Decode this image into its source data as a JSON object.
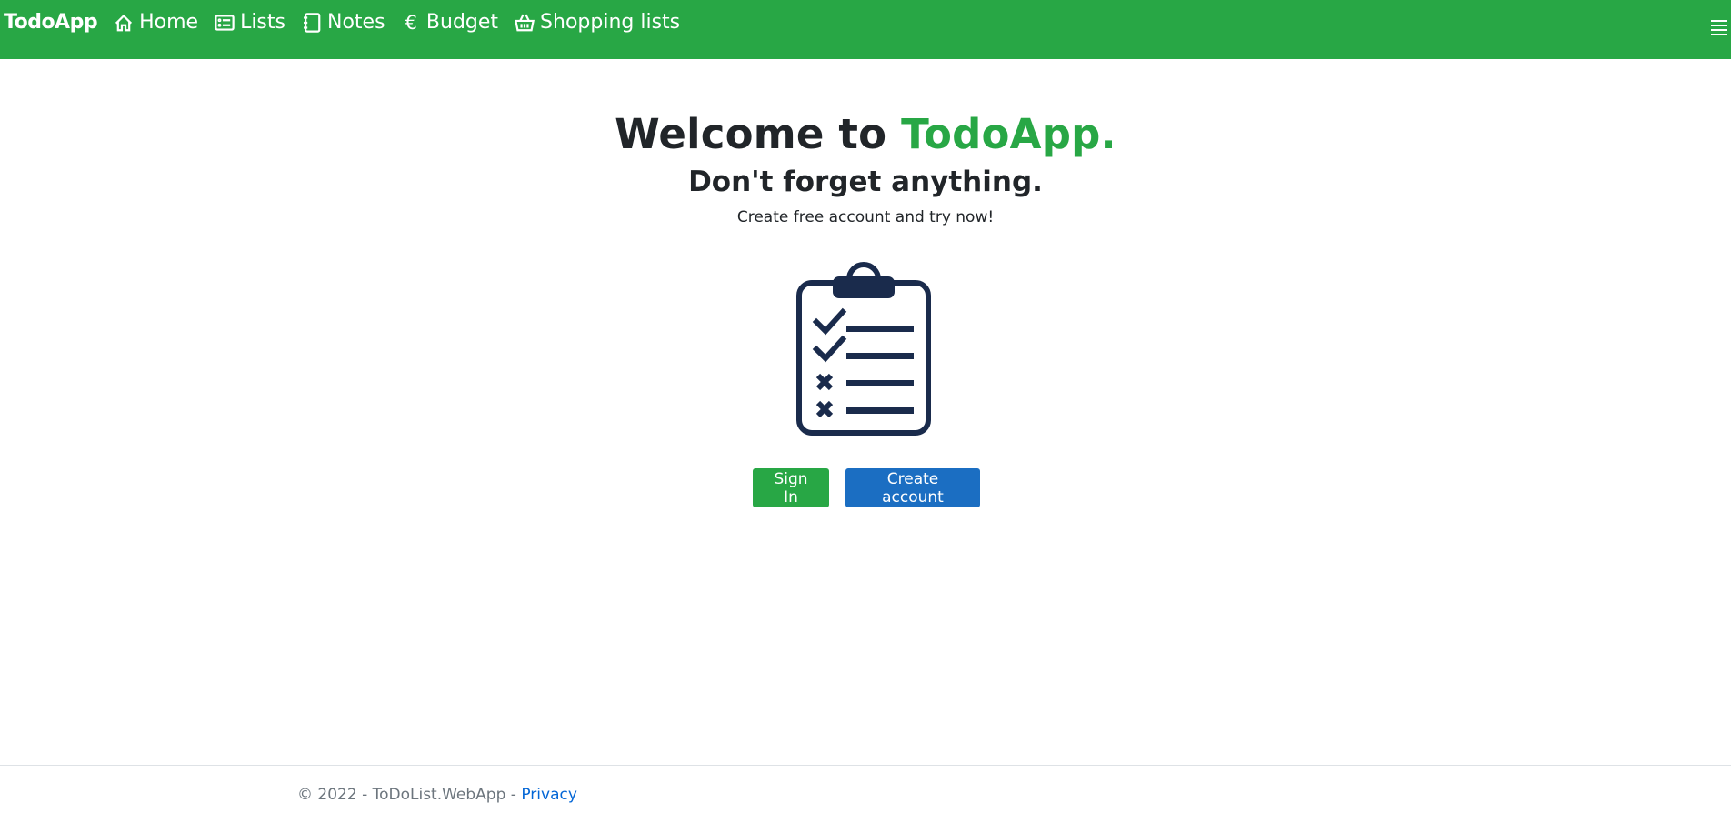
{
  "navbar": {
    "brand": "TodoApp",
    "items": [
      {
        "label": "Home",
        "icon": "house-icon"
      },
      {
        "label": "Lists",
        "icon": "card-list-icon"
      },
      {
        "label": "Notes",
        "icon": "journal-icon"
      },
      {
        "label": "Budget",
        "icon": "euro-icon",
        "glyph": "€"
      },
      {
        "label": "Shopping lists",
        "icon": "basket-icon"
      }
    ],
    "menu_icon": "hamburger-icon"
  },
  "hero": {
    "title_prefix": "Welcome to ",
    "title_accent": "TodoApp.",
    "subtitle": "Don't forget anything.",
    "lead": "Create free account and try now!",
    "illustration": "clipboard-checklist-icon"
  },
  "actions": {
    "sign_in": "Sign In",
    "create_account": "Create account"
  },
  "footer": {
    "copyright": "© 2022 - ToDoList.WebApp - ",
    "privacy_link": "Privacy"
  },
  "colors": {
    "brand_green": "#28a745",
    "primary_blue": "#1b6ec2",
    "icon_navy": "#1a2b4c",
    "link_blue": "#0366d6"
  }
}
